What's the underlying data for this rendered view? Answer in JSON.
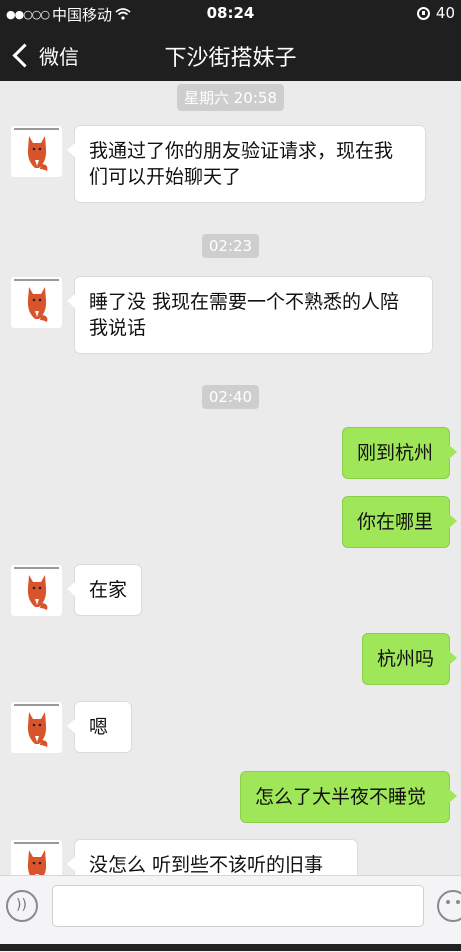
{
  "status_bar": {
    "carrier": "中国移动",
    "time": "08:24",
    "battery": "40"
  },
  "nav": {
    "back_label": "微信",
    "title": "下沙街搭妹子"
  },
  "messages": [
    {
      "type": "time",
      "text": "星期六 20:58"
    },
    {
      "type": "in",
      "text": "我通过了你的朋友验证请求，现在我们可以开始聊天了"
    },
    {
      "type": "time",
      "text": "02:23"
    },
    {
      "type": "in",
      "text": "睡了没 我现在需要一个不熟悉的人陪我说话"
    },
    {
      "type": "time",
      "text": "02:40"
    },
    {
      "type": "out",
      "text": "刚到杭州"
    },
    {
      "type": "out",
      "text": "你在哪里"
    },
    {
      "type": "in",
      "text": "在家"
    },
    {
      "type": "out",
      "text": "杭州吗"
    },
    {
      "type": "in",
      "text": "嗯"
    },
    {
      "type": "out",
      "text": "怎么了大半夜不睡觉"
    },
    {
      "type": "in",
      "text": "没怎么 听到些不该听的旧事"
    }
  ],
  "icons": {
    "voice": "voice-icon",
    "emoji": "emoji-icon",
    "back": "chevron-left-icon",
    "wifi": "wifi-icon",
    "lock": "rotation-lock-icon"
  },
  "colors": {
    "out_bubble": "#9fe658",
    "in_bubble": "#ffffff",
    "bar": "#1f1f1f"
  }
}
